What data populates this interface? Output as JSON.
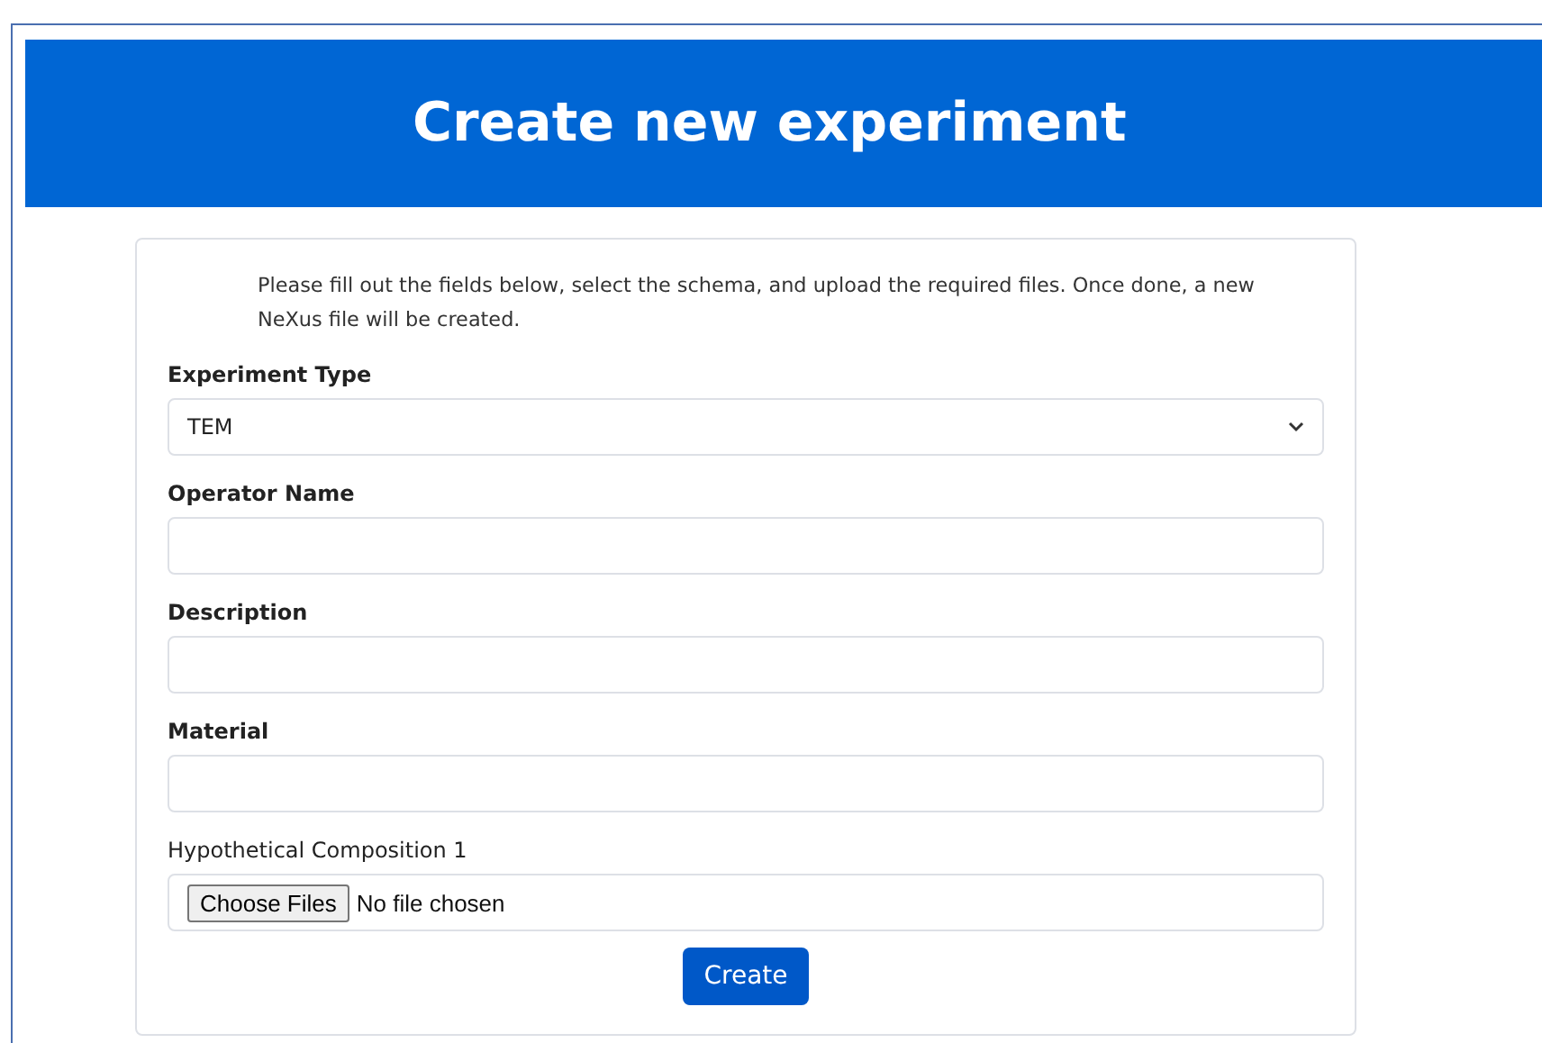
{
  "header": {
    "title": "Create new experiment"
  },
  "form": {
    "intro": "Please fill out the fields below, select the schema, and upload the required files. Once done, a new NeXus file will be created.",
    "fields": [
      {
        "kind": "select",
        "label": "Experiment Type",
        "value": "TEM"
      },
      {
        "kind": "text",
        "label": "Operator Name"
      },
      {
        "kind": "text",
        "label": "Description"
      },
      {
        "kind": "text",
        "label": "Material"
      },
      {
        "kind": "file",
        "label": "Hypothetical Composition 1",
        "button": "Choose Files",
        "status": "No file chosen"
      }
    ],
    "submit": "Create"
  }
}
